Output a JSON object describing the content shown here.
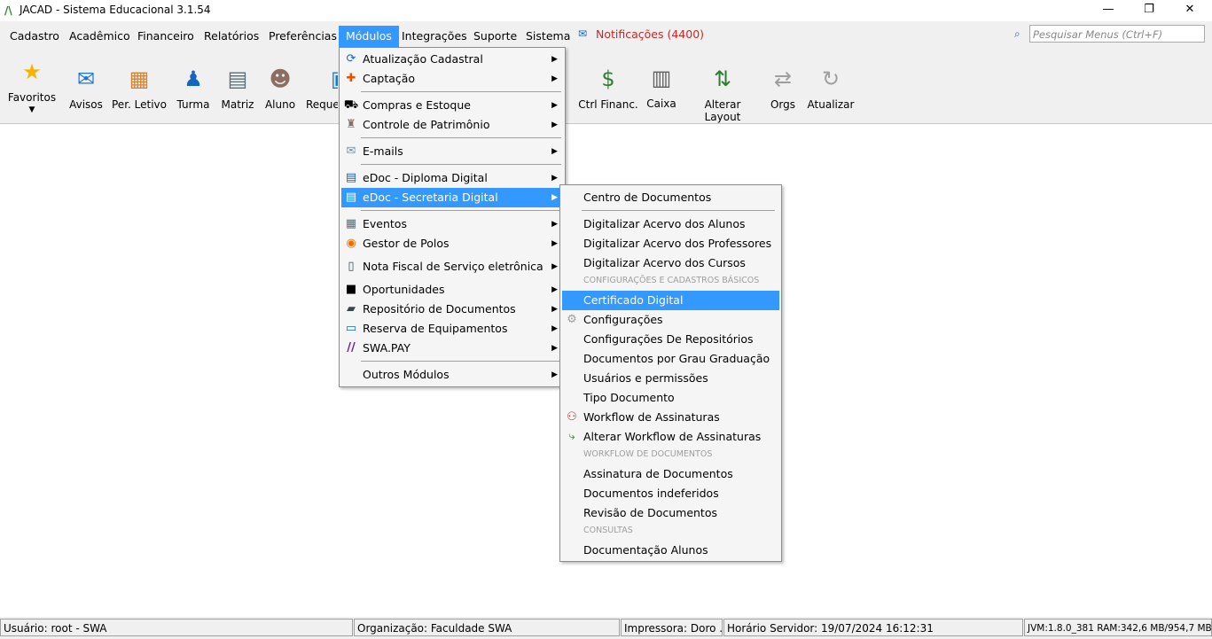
{
  "window": {
    "title": "JACAD - Sistema Educacional 3.1.54",
    "minimize": "—",
    "restore": "❐",
    "close": "✕"
  },
  "menubar": {
    "items": [
      "Cadastro",
      "Acadêmico",
      "Financeiro",
      "Relatórios",
      "Preferências",
      "Módulos",
      "Integrações",
      "Suporte",
      "Sistema"
    ],
    "notifications": "Notificações (4400)",
    "search_placeholder": "Pesquisar Menus (Ctrl+F)"
  },
  "toolbar": {
    "favoritos": "Favoritos",
    "avisos": "Avisos",
    "per_letivo": "Per. Letivo",
    "turma": "Turma",
    "matriz": "Matriz",
    "aluno": "Aluno",
    "reque": "Reque",
    "ctrl_financ": "Ctrl Financ.",
    "caixa": "Caixa",
    "alterar_layout": "Alterar Layout",
    "orgs": "Orgs",
    "atualizar": "Atualizar"
  },
  "modulos_menu": [
    "Atualização Cadastral",
    "Captação",
    "Compras e Estoque",
    "Controle de Patrimônio",
    "E-mails",
    "eDoc - Diploma Digital",
    "eDoc - Secretaria Digital",
    "Eventos",
    "Gestor de Polos",
    "Nota Fiscal de Serviço eletrônica",
    "Oportunidades",
    "Repositório de Documentos",
    "Reserva de Equipamentos",
    "SWA.PAY",
    "Outros Módulos"
  ],
  "submenu": {
    "centro": "Centro de Documentos",
    "dig_alunos": "Digitalizar Acervo dos Alunos",
    "dig_prof": "Digitalizar Acervo dos Professores",
    "dig_cursos": "Digitalizar Acervo dos Cursos",
    "section_config": "CONFIGURAÇÕES E CADASTROS BÁSICOS",
    "certificado": "Certificado Digital",
    "configuracoes": "Configurações",
    "config_repos": "Configurações De Repositórios",
    "docs_grau": "Documentos por Grau Graduação",
    "usuarios": "Usuários e permissões",
    "tipo_doc": "Tipo Documento",
    "workflow": "Workflow de Assinaturas",
    "alterar_workflow": "Alterar Workflow de Assinaturas",
    "section_workflow": "WORKFLOW DE DOCUMENTOS",
    "assinatura": "Assinatura de Documentos",
    "indeferidos": "Documentos indeferidos",
    "revisao": "Revisão de Documentos",
    "section_consultas": "CONSULTAS",
    "doc_alunos": "Documentação Alunos"
  },
  "statusbar": {
    "usuario": "Usuário: root - SWA",
    "organizacao": "Organização: Faculdade SWA",
    "impressora": "Impressora: Doro ...",
    "horario": "Horário Servidor: 19/07/2024 16:12:31",
    "jvm": "JVM:1.8.0_381  RAM:342,6 MB/954,7 MB"
  }
}
